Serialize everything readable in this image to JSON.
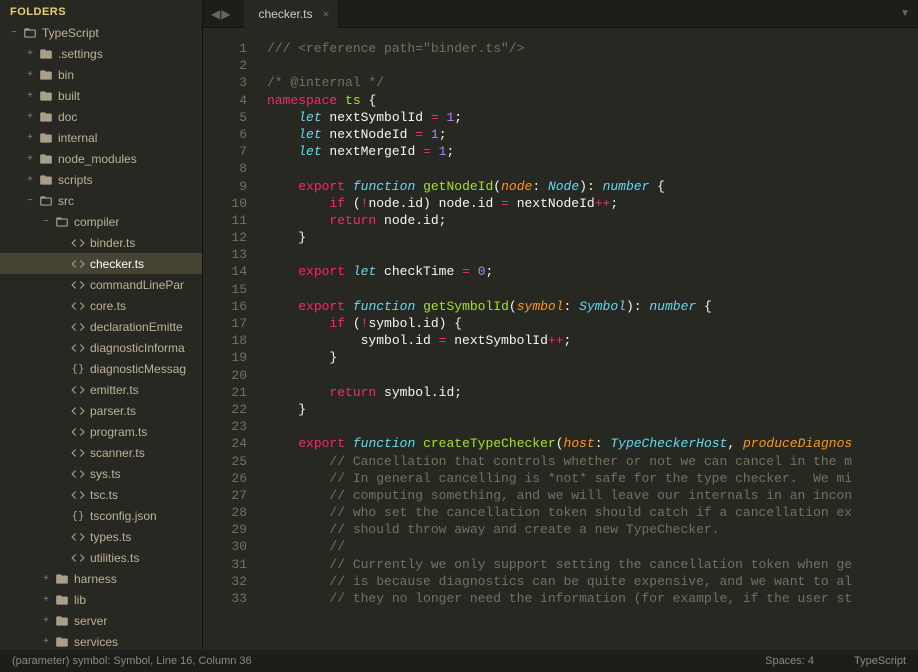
{
  "sidebar": {
    "header": "FOLDERS",
    "tree": [
      {
        "depth": 0,
        "kind": "folder",
        "open": true,
        "label": "TypeScript"
      },
      {
        "depth": 1,
        "kind": "folder",
        "open": false,
        "label": ".settings",
        "collapsed": true
      },
      {
        "depth": 1,
        "kind": "folder",
        "open": false,
        "label": "bin",
        "collapsed": true
      },
      {
        "depth": 1,
        "kind": "folder",
        "open": false,
        "label": "built",
        "collapsed": true
      },
      {
        "depth": 1,
        "kind": "folder",
        "open": false,
        "label": "doc",
        "collapsed": true
      },
      {
        "depth": 1,
        "kind": "folder",
        "open": false,
        "label": "internal",
        "collapsed": true
      },
      {
        "depth": 1,
        "kind": "folder",
        "open": false,
        "label": "node_modules",
        "collapsed": true
      },
      {
        "depth": 1,
        "kind": "folder",
        "open": false,
        "label": "scripts",
        "collapsed": true
      },
      {
        "depth": 1,
        "kind": "folder",
        "open": true,
        "label": "src"
      },
      {
        "depth": 2,
        "kind": "folder",
        "open": true,
        "label": "compiler"
      },
      {
        "depth": 3,
        "kind": "file",
        "ficon": "code",
        "label": "binder.ts"
      },
      {
        "depth": 3,
        "kind": "file",
        "ficon": "code",
        "label": "checker.ts",
        "selected": true
      },
      {
        "depth": 3,
        "kind": "file",
        "ficon": "code",
        "label": "commandLinePar"
      },
      {
        "depth": 3,
        "kind": "file",
        "ficon": "code",
        "label": "core.ts"
      },
      {
        "depth": 3,
        "kind": "file",
        "ficon": "code",
        "label": "declarationEmitte"
      },
      {
        "depth": 3,
        "kind": "file",
        "ficon": "code",
        "label": "diagnosticInforma"
      },
      {
        "depth": 3,
        "kind": "file",
        "ficon": "json",
        "label": "diagnosticMessag"
      },
      {
        "depth": 3,
        "kind": "file",
        "ficon": "code",
        "label": "emitter.ts"
      },
      {
        "depth": 3,
        "kind": "file",
        "ficon": "code",
        "label": "parser.ts"
      },
      {
        "depth": 3,
        "kind": "file",
        "ficon": "code",
        "label": "program.ts"
      },
      {
        "depth": 3,
        "kind": "file",
        "ficon": "code",
        "label": "scanner.ts"
      },
      {
        "depth": 3,
        "kind": "file",
        "ficon": "code",
        "label": "sys.ts"
      },
      {
        "depth": 3,
        "kind": "file",
        "ficon": "code",
        "label": "tsc.ts"
      },
      {
        "depth": 3,
        "kind": "file",
        "ficon": "json",
        "label": "tsconfig.json"
      },
      {
        "depth": 3,
        "kind": "file",
        "ficon": "code",
        "label": "types.ts"
      },
      {
        "depth": 3,
        "kind": "file",
        "ficon": "code",
        "label": "utilities.ts"
      },
      {
        "depth": 2,
        "kind": "folder",
        "open": false,
        "label": "harness",
        "collapsed": true
      },
      {
        "depth": 2,
        "kind": "folder",
        "open": false,
        "label": "lib",
        "collapsed": true
      },
      {
        "depth": 2,
        "kind": "folder",
        "open": false,
        "label": "server",
        "collapsed": true
      },
      {
        "depth": 2,
        "kind": "folder",
        "open": false,
        "label": "services",
        "collapsed": true
      }
    ]
  },
  "tabs": {
    "active": "checker.ts"
  },
  "code_lines": [
    {
      "n": 1,
      "html": "<span class='com'>/// &lt;reference path=\"binder.ts\"/&gt;</span>"
    },
    {
      "n": 2,
      "html": ""
    },
    {
      "n": 3,
      "html": "<span class='com'>/* @internal */</span>"
    },
    {
      "n": 4,
      "html": "<span class='kw'>namespace</span> <span class='fn'>ts</span> {"
    },
    {
      "n": 5,
      "html": "    <span class='kw2'>let</span> nextSymbolId <span class='op'>=</span> <span class='num'>1</span>;"
    },
    {
      "n": 6,
      "html": "    <span class='kw2'>let</span> nextNodeId <span class='op'>=</span> <span class='num'>1</span>;"
    },
    {
      "n": 7,
      "html": "    <span class='kw2'>let</span> nextMergeId <span class='op'>=</span> <span class='num'>1</span>;"
    },
    {
      "n": 8,
      "html": ""
    },
    {
      "n": 9,
      "html": "    <span class='kw'>export</span> <span class='kw2'>function</span> <span class='fn'>getNodeId</span>(<span class='param'>node</span>: <span class='type'>Node</span>): <span class='type'>number</span> {"
    },
    {
      "n": 10,
      "html": "        <span class='kw'>if</span> (<span class='op'>!</span>node.id) node.id <span class='op'>=</span> nextNodeId<span class='op'>++</span>;"
    },
    {
      "n": 11,
      "html": "        <span class='kw'>return</span> node.id;"
    },
    {
      "n": 12,
      "html": "    }"
    },
    {
      "n": 13,
      "html": ""
    },
    {
      "n": 14,
      "html": "    <span class='kw'>export</span> <span class='kw2'>let</span> checkTime <span class='op'>=</span> <span class='num'>0</span>;"
    },
    {
      "n": 15,
      "html": ""
    },
    {
      "n": 16,
      "html": "    <span class='kw'>export</span> <span class='kw2'>function</span> <span class='fn'>getSymbolId</span>(<span class='param'>symbol</span>: <span class='type'>Symbol</span>): <span class='type'>number</span> {"
    },
    {
      "n": 17,
      "html": "        <span class='kw'>if</span> (<span class='op'>!</span>symbol.id) {"
    },
    {
      "n": 18,
      "html": "            symbol.id <span class='op'>=</span> nextSymbolId<span class='op'>++</span>;"
    },
    {
      "n": 19,
      "html": "        }"
    },
    {
      "n": 20,
      "html": ""
    },
    {
      "n": 21,
      "html": "        <span class='kw'>return</span> symbol.id;"
    },
    {
      "n": 22,
      "html": "    }"
    },
    {
      "n": 23,
      "html": ""
    },
    {
      "n": 24,
      "html": "    <span class='kw'>export</span> <span class='kw2'>function</span> <span class='fn'>createTypeChecker</span>(<span class='param'>host</span>: <span class='type'>TypeCheckerHost</span>, <span class='param'>produceDiagnos</span>"
    },
    {
      "n": 25,
      "html": "        <span class='com'>// Cancellation that controls whether or not we can cancel in the m</span>"
    },
    {
      "n": 26,
      "html": "        <span class='com'>// In general cancelling is *not* safe for the type checker.  We mi</span>"
    },
    {
      "n": 27,
      "html": "        <span class='com'>// computing something, and we will leave our internals in an incon</span>"
    },
    {
      "n": 28,
      "html": "        <span class='com'>// who set the cancellation token should catch if a cancellation ex</span>"
    },
    {
      "n": 29,
      "html": "        <span class='com'>// should throw away and create a new TypeChecker.</span>"
    },
    {
      "n": 30,
      "html": "        <span class='com'>//</span>"
    },
    {
      "n": 31,
      "html": "        <span class='com'>// Currently we only support setting the cancellation token when ge</span>"
    },
    {
      "n": 32,
      "html": "        <span class='com'>// is because diagnostics can be quite expensive, and we want to al</span>"
    },
    {
      "n": 33,
      "html": "        <span class='com'>// they no longer need the information (for example, if the user st</span>"
    }
  ],
  "status": {
    "left": "(parameter) symbol: Symbol, Line 16, Column 36",
    "spaces": "Spaces: 4",
    "lang": "TypeScript"
  }
}
